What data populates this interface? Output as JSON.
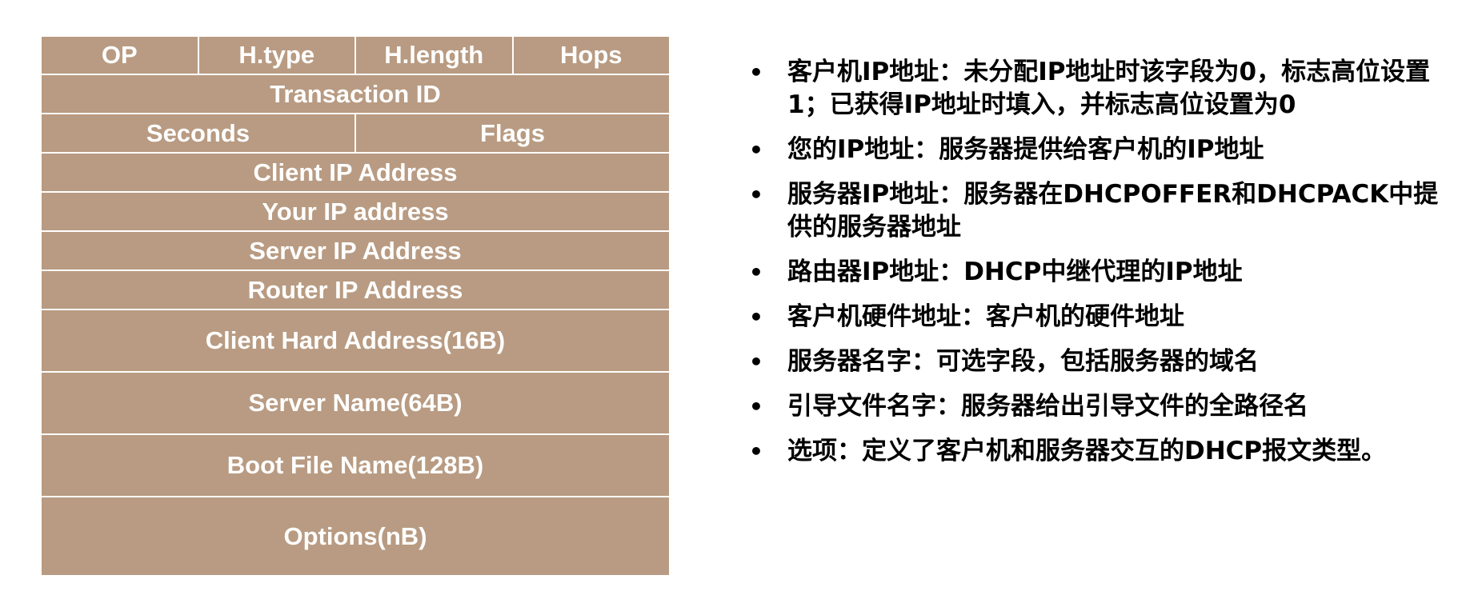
{
  "packet": {
    "rows": [
      [
        "OP",
        "H.type",
        "H.length",
        "Hops"
      ],
      [
        "Transaction ID"
      ],
      [
        "Seconds",
        "Flags"
      ],
      [
        "Client IP Address"
      ],
      [
        "Your IP address"
      ],
      [
        "Server IP Address"
      ],
      [
        "Router IP Address"
      ],
      [
        "Client Hard Address(16B)"
      ],
      [
        "Server Name(64B)"
      ],
      [
        "Boot File Name(128B)"
      ],
      [
        "Options(nB)"
      ]
    ],
    "fill_color": "#b89b82",
    "text_color": "#ffffff"
  },
  "descriptions": {
    "bullet": "•",
    "items": [
      "客户机IP地址：未分配IP地址时该字段为0，标志高位设置1；已获得IP地址时填入，并标志高位设置为0",
      "您的IP地址：服务器提供给客户机的IP地址",
      "服务器IP地址：服务器在DHCPOFFER和DHCPACK中提供的服务器地址",
      "路由器IP地址：DHCP中继代理的IP地址",
      "客户机硬件地址：客户机的硬件地址",
      "服务器名字：可选字段，包括服务器的域名",
      "引导文件名字：服务器给出引导文件的全路径名",
      "选项：定义了客户机和服务器交互的DHCP报文类型。"
    ]
  }
}
